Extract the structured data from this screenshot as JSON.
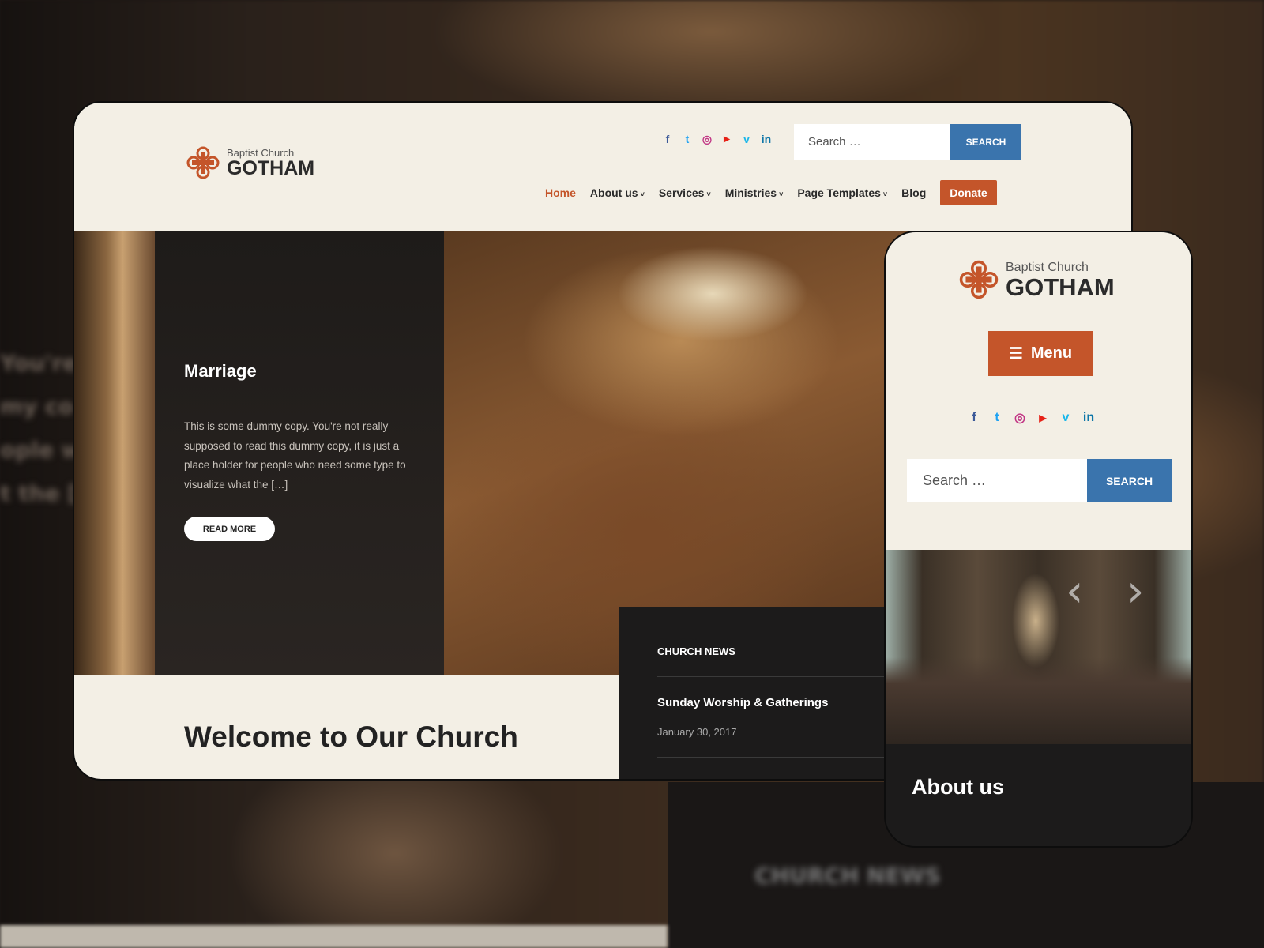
{
  "brand": {
    "subtitle": "Baptist Church",
    "name": "GOTHAM"
  },
  "social": [
    {
      "icon": "facebook-icon",
      "glyph": "f",
      "color": "#3b5998"
    },
    {
      "icon": "twitter-icon",
      "glyph": "t",
      "color": "#1da1f2"
    },
    {
      "icon": "instagram-icon",
      "glyph": "◎",
      "color": "#c13584"
    },
    {
      "icon": "youtube-icon",
      "glyph": "▶",
      "color": "#e62117"
    },
    {
      "icon": "vimeo-icon",
      "glyph": "v",
      "color": "#1ab7ea"
    },
    {
      "icon": "linkedin-icon",
      "glyph": "in",
      "color": "#0e76a8"
    }
  ],
  "search": {
    "placeholder": "Search …",
    "button": "SEARCH"
  },
  "nav": {
    "items": [
      "Home",
      "About us",
      "Services",
      "Ministries",
      "Page Templates",
      "Blog"
    ],
    "donate": "Donate"
  },
  "hero": {
    "title": "Marriage",
    "text": "This is some dummy copy. You're not really supposed to read this dummy copy, it is just a place holder for people who need some type to visualize what the […]",
    "button": "READ MORE"
  },
  "welcome": "Welcome to Our Church",
  "news": {
    "heading": "CHURCH NEWS",
    "items": [
      {
        "title": "Sunday Worship & Gatherings",
        "date": "January 30, 2017"
      }
    ]
  },
  "mobile": {
    "menu": "Menu",
    "section_title": "About us"
  },
  "colors": {
    "accent": "#c4552a",
    "search_button": "#3a74ad",
    "cream": "#f3efe5",
    "dark": "#1c1b1b"
  },
  "background_blur": {
    "left_text": [
      "You're",
      "my co",
      "ople who",
      "t the ["
    ],
    "news_text": "CHURCH NEWS"
  }
}
